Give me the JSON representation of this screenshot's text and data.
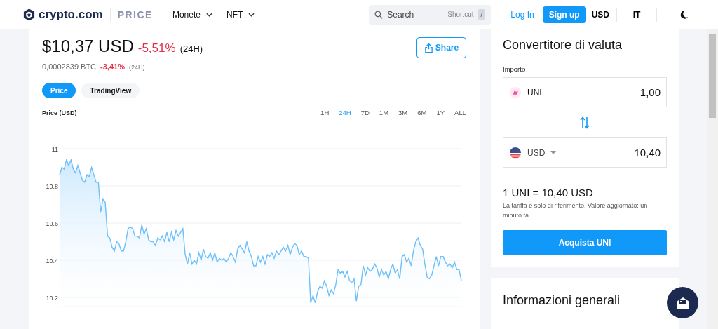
{
  "header": {
    "brand": "crypto.com",
    "section": "PRICE",
    "nav": [
      {
        "label": "Monete"
      },
      {
        "label": "NFT"
      }
    ],
    "search": {
      "placeholder": "Search",
      "shortcut_label": "Shortcut",
      "shortcut_key": "/"
    },
    "login": "Log In",
    "signup": "Sign up",
    "currency": "USD",
    "language": "IT"
  },
  "price": {
    "value": "$10,37 USD",
    "change": "-5,51%",
    "period": "(24H)",
    "btc_value": "0,0002839 BTC",
    "btc_change": "-3,41%",
    "btc_period": "(24H)",
    "share": "Share"
  },
  "chart_tabs": [
    {
      "label": "Price",
      "selected": true
    },
    {
      "label": "TradingView",
      "selected": false
    }
  ],
  "ranges": [
    {
      "label": "1H",
      "selected": false
    },
    {
      "label": "24H",
      "selected": true
    },
    {
      "label": "7D",
      "selected": false
    },
    {
      "label": "1M",
      "selected": false
    },
    {
      "label": "3M",
      "selected": false
    },
    {
      "label": "6M",
      "selected": false
    },
    {
      "label": "1Y",
      "selected": false
    },
    {
      "label": "ALL",
      "selected": false
    }
  ],
  "chart_data": {
    "type": "area",
    "ylabel": "Price (USD)",
    "grid": true,
    "ylim": [
      10.15,
      11
    ],
    "yticks": [
      10.2,
      10.4,
      10.6,
      10.8,
      11
    ],
    "series": [
      {
        "color": "#6cc0fb",
        "values": [
          10.86,
          10.9,
          10.89,
          10.94,
          10.91,
          10.94,
          10.89,
          10.87,
          10.91,
          10.87,
          10.83,
          10.82,
          10.86,
          10.85,
          10.9,
          10.86,
          10.82,
          10.82,
          10.66,
          10.73,
          10.71,
          10.53,
          10.52,
          10.47,
          10.45,
          10.5,
          10.49,
          10.45,
          10.45,
          10.5,
          10.57,
          10.58,
          10.57,
          10.53,
          10.53,
          10.52,
          10.59,
          10.54,
          10.57,
          10.51,
          10.5,
          10.5,
          10.48,
          10.52,
          10.51,
          10.53,
          10.5,
          10.55,
          10.5,
          10.55,
          10.51,
          10.56,
          10.53,
          10.55,
          10.57,
          10.43,
          10.38,
          10.44,
          10.38,
          10.4,
          10.38,
          10.44,
          10.4,
          10.46,
          10.42,
          10.41,
          10.44,
          10.4,
          10.44,
          10.39,
          10.41,
          10.4,
          10.41,
          10.39,
          10.41,
          10.44,
          10.42,
          10.39,
          10.46,
          10.48,
          10.46,
          10.44,
          10.5,
          10.45,
          10.42,
          10.37,
          10.37,
          10.42,
          10.39,
          10.42,
          10.38,
          10.43,
          10.42,
          10.44,
          10.41,
          10.45,
          10.43,
          10.45,
          10.47,
          10.45,
          10.48,
          10.43,
          10.47,
          10.49,
          10.48,
          10.43,
          10.45,
          10.42,
          10.42,
          10.41,
          10.17,
          10.21,
          10.17,
          10.23,
          10.26,
          10.25,
          10.29,
          10.26,
          10.21,
          10.24,
          10.22,
          10.27,
          10.35,
          10.33,
          10.34,
          10.31,
          10.34,
          10.29,
          10.28,
          10.3,
          10.18,
          10.26,
          10.27,
          10.37,
          10.32,
          10.36,
          10.34,
          10.35,
          10.38,
          10.36,
          10.31,
          10.35,
          10.32,
          10.34,
          10.3,
          10.35,
          10.38,
          10.33,
          10.35,
          10.3,
          10.42,
          10.43,
          10.39,
          10.41,
          10.37,
          10.45,
          10.5,
          10.52,
          10.48,
          10.46,
          10.38,
          10.31,
          10.3,
          10.32,
          10.37,
          10.42,
          10.37,
          10.42,
          10.42,
          10.39,
          10.37,
          10.38,
          10.36,
          10.39,
          10.35,
          10.35,
          10.29
        ]
      }
    ]
  },
  "converter": {
    "title": "Convertitore di valuta",
    "amount_label": "Importo",
    "from": {
      "currency": "UNI",
      "value": "1,00"
    },
    "to": {
      "currency": "USD",
      "value": "10,40"
    },
    "rate": "1 UNI = 10,40 USD",
    "note": "La tariffa è solo di riferimento. Valore aggiornato: un minuto fa",
    "buy": "Acquista UNI"
  },
  "info_title": "Informazioni generali"
}
